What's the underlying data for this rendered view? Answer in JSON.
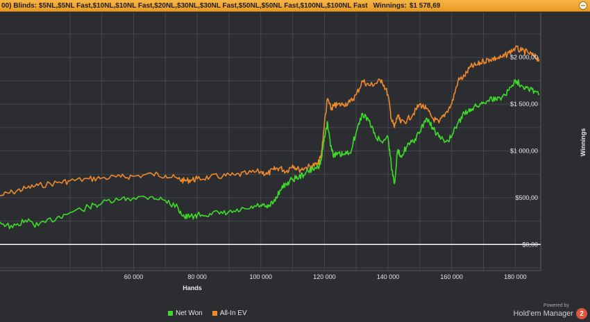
{
  "header": {
    "text": "00) Blinds: $5NL,$5NL Fast,$10NL,$10NL Fast,$20NL,$30NL,$30NL Fast,$50NL,$50NL Fast,$100NL,$100NL Fast",
    "winnings_label": "Winnings:",
    "winnings_value": "$1 578,69"
  },
  "legend": {
    "net_won": "Net Won",
    "all_in_ev": "All-In EV"
  },
  "branding": {
    "powered_by": "Powered by",
    "product": "Hold'em Manager",
    "badge": "2"
  },
  "colors": {
    "background": "#2b2d31",
    "grid": "#45474c",
    "net_won": "#3fdb2a",
    "all_in_ev": "#f0892b",
    "zero_line": "#ffffff",
    "header": "#f2a73a"
  },
  "chart_data": {
    "type": "line",
    "title": "",
    "xlabel": "Hands",
    "ylabel": "Winnings",
    "xlim": [
      18000,
      188000
    ],
    "ylim": [
      -280,
      2480
    ],
    "x_ticks": [
      60000,
      80000,
      100000,
      120000,
      140000,
      160000,
      180000
    ],
    "x_tick_labels": [
      "60 000",
      "80 000",
      "100 000",
      "120 000",
      "140 000",
      "160 000",
      "180 000"
    ],
    "y_ticks": [
      0,
      500,
      1000,
      1500,
      2000
    ],
    "y_tick_labels": [
      "$0,00",
      "$500,00",
      "$1 000,00",
      "$1 500,00",
      "$2 000,00"
    ],
    "grid": true,
    "legend_position": "bottom",
    "series": [
      {
        "name": "Net Won",
        "x": [
          18000,
          22000,
          26000,
          30000,
          36000,
          40000,
          46000,
          50000,
          56000,
          60000,
          66000,
          70000,
          74000,
          76000,
          78000,
          80000,
          84000,
          88000,
          92000,
          96000,
          100000,
          102000,
          104000,
          106000,
          108000,
          110000,
          112000,
          114000,
          116000,
          118000,
          119000,
          120000,
          121000,
          122000,
          123000,
          124000,
          126000,
          128000,
          130000,
          132000,
          134000,
          136000,
          138000,
          140000,
          141000,
          142000,
          143000,
          144000,
          146000,
          148000,
          150000,
          152000,
          154000,
          156000,
          158000,
          160000,
          162000,
          164000,
          166000,
          168000,
          170000,
          172000,
          174000,
          176000,
          178000,
          180000,
          182000,
          184000,
          186000,
          187500
        ],
        "y": [
          240,
          180,
          260,
          200,
          290,
          340,
          400,
          440,
          480,
          500,
          510,
          470,
          390,
          290,
          300,
          310,
          330,
          330,
          350,
          380,
          420,
          390,
          450,
          580,
          650,
          700,
          720,
          760,
          800,
          830,
          900,
          1150,
          1300,
          1050,
          950,
          960,
          960,
          980,
          1200,
          1400,
          1320,
          1160,
          1100,
          1150,
          850,
          650,
          1000,
          950,
          1050,
          1100,
          1200,
          1350,
          1250,
          1150,
          1100,
          1150,
          1300,
          1400,
          1450,
          1480,
          1520,
          1560,
          1550,
          1580,
          1650,
          1760,
          1700,
          1680,
          1640,
          1610
        ]
      },
      {
        "name": "All-In EV",
        "x": [
          18000,
          22000,
          26000,
          30000,
          36000,
          40000,
          46000,
          50000,
          56000,
          60000,
          66000,
          70000,
          74000,
          76000,
          78000,
          80000,
          84000,
          88000,
          92000,
          96000,
          100000,
          102000,
          104000,
          106000,
          108000,
          110000,
          112000,
          114000,
          116000,
          118000,
          119000,
          120000,
          121000,
          122000,
          123000,
          124000,
          126000,
          128000,
          130000,
          132000,
          134000,
          136000,
          138000,
          140000,
          141000,
          142000,
          143000,
          144000,
          146000,
          148000,
          150000,
          152000,
          154000,
          156000,
          158000,
          160000,
          162000,
          164000,
          166000,
          168000,
          170000,
          172000,
          174000,
          176000,
          178000,
          180000,
          182000,
          184000,
          186000,
          187500
        ],
        "y": [
          520,
          560,
          600,
          630,
          660,
          680,
          700,
          710,
          720,
          730,
          750,
          740,
          700,
          680,
          690,
          700,
          720,
          730,
          740,
          760,
          780,
          750,
          800,
          820,
          780,
          850,
          800,
          820,
          840,
          860,
          950,
          1300,
          1560,
          1450,
          1480,
          1490,
          1500,
          1520,
          1600,
          1750,
          1700,
          1720,
          1760,
          1600,
          1350,
          1250,
          1380,
          1300,
          1330,
          1400,
          1500,
          1450,
          1350,
          1300,
          1400,
          1500,
          1750,
          1800,
          1900,
          1920,
          1960,
          1980,
          1990,
          2000,
          2050,
          2100,
          2070,
          2050,
          2010,
          1980
        ]
      }
    ]
  }
}
